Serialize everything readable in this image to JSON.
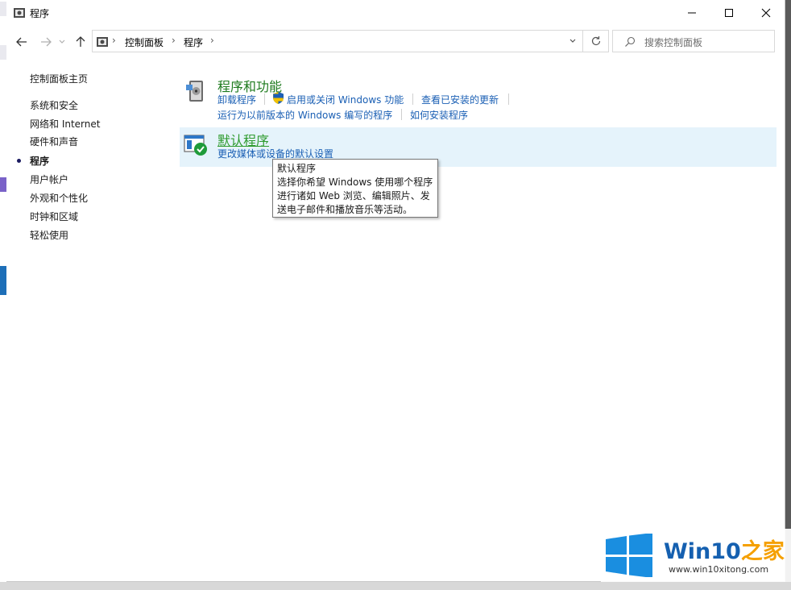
{
  "window": {
    "title": "程序",
    "controls": {
      "minimize": "minimize",
      "maximize": "maximize",
      "close": "close"
    }
  },
  "address": {
    "breadcrumbs": [
      "控制面板",
      "程序"
    ],
    "search_placeholder": "搜索控制面板"
  },
  "sidebar": {
    "home": "控制面板主页",
    "items": [
      {
        "label": "系统和安全",
        "active": false
      },
      {
        "label": "网络和 Internet",
        "active": false
      },
      {
        "label": "硬件和声音",
        "active": false
      },
      {
        "label": "程序",
        "active": true
      },
      {
        "label": "用户帐户",
        "active": false
      },
      {
        "label": "外观和个性化",
        "active": false
      },
      {
        "label": "时钟和区域",
        "active": false
      },
      {
        "label": "轻松使用",
        "active": false
      }
    ]
  },
  "main": {
    "programs_features": {
      "title": "程序和功能",
      "links": [
        "卸载程序",
        "启用或关闭 Windows 功能",
        "查看已安装的更新",
        "运行为以前版本的 Windows 编写的程序",
        "如何安装程序"
      ]
    },
    "default_programs": {
      "title": "默认程序",
      "links": [
        "更改媒体或设备的默认设置"
      ]
    }
  },
  "tooltip": {
    "title": "默认程序",
    "lines": [
      "选择你希望 Windows 使用哪个程序",
      "进行诸如 Web 浏览、编辑照片、发",
      "送电子邮件和播放音乐等活动。"
    ]
  },
  "watermark": {
    "brand": "Win10",
    "brand_zh": "之家",
    "url": "www.win10xitong.com"
  },
  "colors": {
    "accent_link": "#1a5fb4",
    "category_title": "#1e7a1e",
    "highlight": "#e5f3fb"
  }
}
